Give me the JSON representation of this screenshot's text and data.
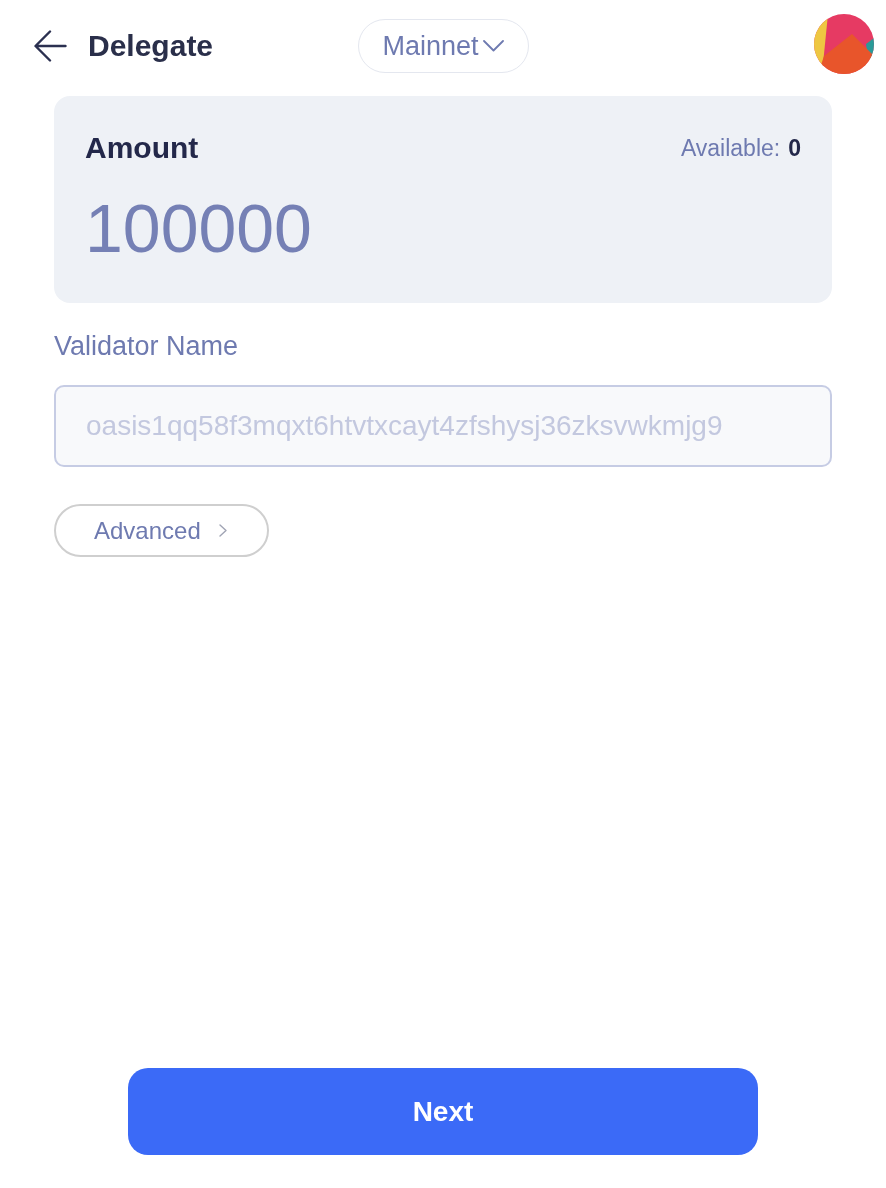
{
  "header": {
    "title": "Delegate",
    "network": {
      "label": "Mainnet"
    }
  },
  "amount": {
    "label": "Amount",
    "available_label": "Available:",
    "available_value": "0",
    "value": "100000"
  },
  "validator": {
    "label": "Validator Name",
    "placeholder": "oasis1qq58f3mqxt6htvtxcayt4zfshysj36zksvwkmjg9"
  },
  "advanced": {
    "label": "Advanced",
    "expanded": false
  },
  "next_button": {
    "label": "Next"
  }
}
